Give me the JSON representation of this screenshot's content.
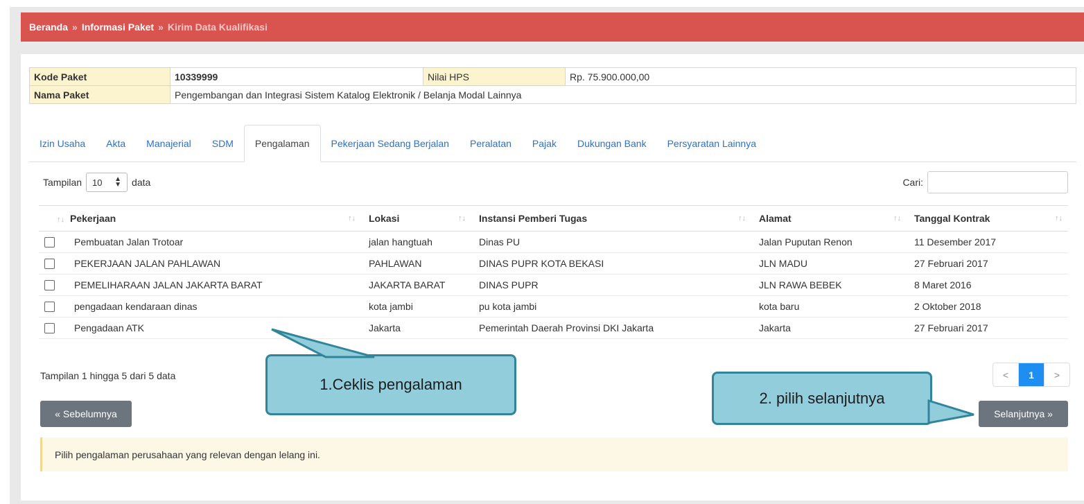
{
  "breadcrumb": {
    "items": [
      "Beranda",
      "Informasi Paket",
      "Kirim Data Kualifikasi"
    ],
    "separator": "»"
  },
  "package": {
    "kode_label": "Kode Paket",
    "kode_value": "10339999",
    "hps_label": "Nilai HPS",
    "hps_value": "Rp. 75.900.000,00",
    "nama_label": "Nama Paket",
    "nama_value": "Pengembangan dan Integrasi Sistem Katalog Elektronik / Belanja Modal Lainnya"
  },
  "tabs": [
    {
      "label": "Izin Usaha",
      "active": false
    },
    {
      "label": "Akta",
      "active": false
    },
    {
      "label": "Manajerial",
      "active": false
    },
    {
      "label": "SDM",
      "active": false
    },
    {
      "label": "Pengalaman",
      "active": true
    },
    {
      "label": "Pekerjaan Sedang Berjalan",
      "active": false
    },
    {
      "label": "Peralatan",
      "active": false
    },
    {
      "label": "Pajak",
      "active": false
    },
    {
      "label": "Dukungan Bank",
      "active": false
    },
    {
      "label": "Persyaratan Lainnya",
      "active": false
    }
  ],
  "table_controls": {
    "show_label": "Tampilan",
    "show_value": "10",
    "show_suffix": "data",
    "search_label": "Cari:",
    "search_value": ""
  },
  "table": {
    "headers": [
      "Pekerjaan",
      "Lokasi",
      "Instansi Pemberi Tugas",
      "Alamat",
      "Tanggal Kontrak"
    ],
    "rows": [
      {
        "checked": false,
        "pekerjaan": "Pembuatan Jalan Trotoar",
        "lokasi": "jalan hangtuah",
        "instansi": "Dinas PU",
        "alamat": "Jalan Puputan Renon",
        "tanggal": "11 Desember 2017"
      },
      {
        "checked": false,
        "pekerjaan": "PEKERJAAN JALAN PAHLAWAN",
        "lokasi": "PAHLAWAN",
        "instansi": "DINAS PUPR KOTA BEKASI",
        "alamat": "JLN MADU",
        "tanggal": "27 Februari 2017"
      },
      {
        "checked": false,
        "pekerjaan": "PEMELIHARAAN JALAN JAKARTA BARAT",
        "lokasi": "JAKARTA BARAT",
        "instansi": "DINAS PUPR",
        "alamat": "JLN RAWA BEBEK",
        "tanggal": "8 Maret 2016"
      },
      {
        "checked": false,
        "pekerjaan": "pengadaan kendaraan dinas",
        "lokasi": "kota jambi",
        "instansi": "pu kota jambi",
        "alamat": "kota baru",
        "tanggal": "2 Oktober 2018"
      },
      {
        "checked": false,
        "pekerjaan": "Pengadaan ATK",
        "lokasi": "Jakarta",
        "instansi": "Pemerintah Daerah Provinsi DKI Jakarta",
        "alamat": "Jakarta",
        "tanggal": "27 Februari 2017"
      }
    ],
    "info": "Tampilan 1 hingga 5 dari 5 data"
  },
  "pagination": {
    "prev": "<",
    "current": "1",
    "next": ">"
  },
  "buttons": {
    "prev_label": "« Sebelumnya",
    "next_label": "Selanjutnya »"
  },
  "notice": "Pilih pengalaman perusahaan yang relevan dengan lelang ini.",
  "callouts": {
    "one": "1.Ceklis pengalaman",
    "two": "2. pilih selanjutnya"
  },
  "colors": {
    "breadcrumb_bg": "#d9534f",
    "accent": "#1f8ef1",
    "callout_fill": "#92cddc",
    "callout_border": "#31859b",
    "button_bg": "#6c757d"
  }
}
